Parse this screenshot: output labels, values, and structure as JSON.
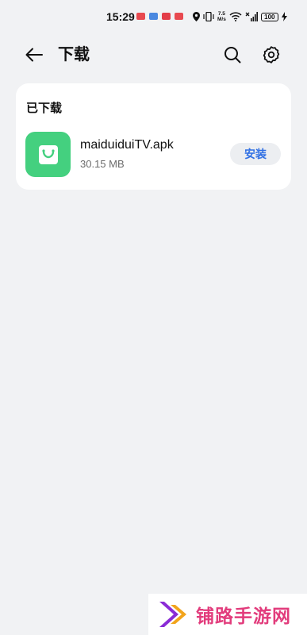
{
  "status_bar": {
    "time": "15:29",
    "net_speed_value": "7.5",
    "net_speed_unit": "M/s",
    "battery": "100",
    "notification_colors": [
      "#e8494f",
      "#4a88e0",
      "#e33d48",
      "#e8494f"
    ]
  },
  "header": {
    "title": "下载",
    "back_icon": "arrow-left-icon",
    "search_icon": "search-icon",
    "settings_icon": "gear-icon"
  },
  "downloaded": {
    "section_title": "已下载",
    "items": [
      {
        "name": "maiduiduiTV.apk",
        "size": "30.15 MB",
        "action_label": "安装",
        "icon": "shopping-bag-icon",
        "icon_color": "#44d07f"
      }
    ]
  },
  "watermark": {
    "text": "铺路手游网"
  },
  "colors": {
    "background": "#f1f2f4",
    "card": "#ffffff",
    "accent": "#2f6fe4",
    "watermark_text": "#e23c7c"
  }
}
